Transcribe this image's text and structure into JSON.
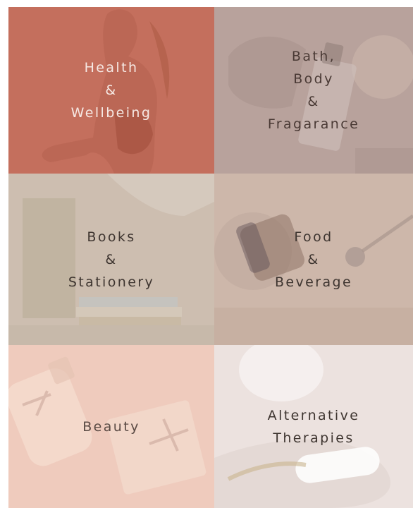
{
  "tiles": [
    {
      "id": "health",
      "lines": [
        "Health",
        "&",
        "Wellbeing"
      ]
    },
    {
      "id": "bath",
      "lines": [
        "Bath,",
        "Body",
        "&",
        "Fragarance"
      ]
    },
    {
      "id": "books",
      "lines": [
        "Books",
        "&",
        "Stationery"
      ]
    },
    {
      "id": "food",
      "lines": [
        "Food",
        "&",
        "Beverage"
      ]
    },
    {
      "id": "beauty",
      "lines": [
        "Beauty"
      ]
    },
    {
      "id": "therapies",
      "lines": [
        "Alternative",
        "Therapies"
      ]
    }
  ],
  "colors": {
    "health": "#c46f5d",
    "bath": "#b8a29c",
    "books": "#cdbeb0",
    "food": "#cdb7aa",
    "beauty": "#efcbbd",
    "therapies": "#ece2df"
  }
}
